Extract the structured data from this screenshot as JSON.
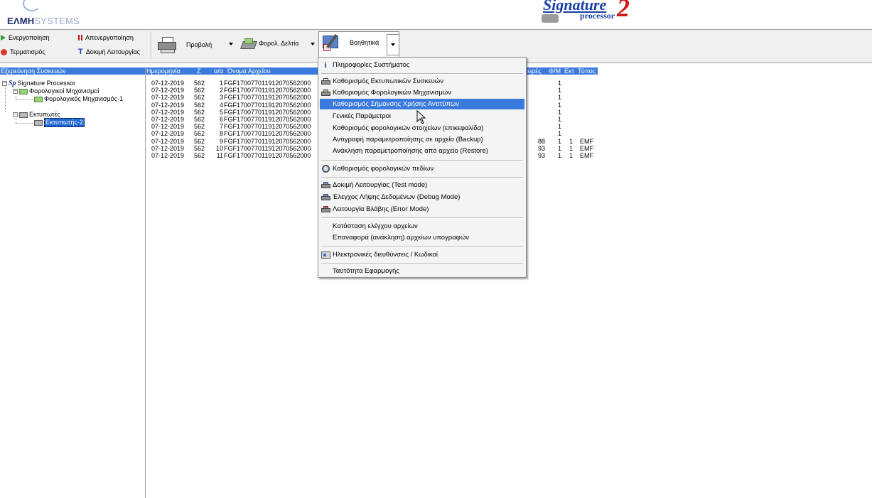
{
  "banner": {
    "brand_main": "ΕΛΜΗ",
    "brand_sub": "SYSTEMS",
    "product_word": "Signature",
    "product_num": "2",
    "product_sub": "processor"
  },
  "toolbar": {
    "activate": "Ενεργοποίηση",
    "deactivate": "Απενεργοποίηση",
    "terminate": "Τερματισμός",
    "test_run": "Δοκιμή Λειτουργίας",
    "preview": "Προβολή",
    "tax_slips": "Φορολ. Δελτία",
    "utilities": "Βοηθητικά"
  },
  "tree": {
    "header": "Εξερεύνηση Συσκευών",
    "root_prefix": "Sp",
    "root_label": "Signature Processor",
    "fiscal_group": "Φορολογικοί Μηχανισμοί",
    "fiscal_item": "Φορολογικός Μηχανισμός-1",
    "printers_group": "Εκτυπωτές",
    "printer_item": "Εκτυπωτής-2"
  },
  "list": {
    "headers": {
      "date": "Ημερομηνία",
      "z": "Z",
      "seq": "α/α",
      "filename": "Όνομα Αρχείου",
      "rows_col": "ειρές",
      "fm": "Φ/Μ",
      "ext": "Εκτ",
      "type": "Τύπος"
    },
    "rows": [
      {
        "date": "07-12-2019",
        "z": "562",
        "seq": "1",
        "file": "FGF170077011912070562000",
        "lines": "",
        "fm": "1",
        "ext": "",
        "type": ""
      },
      {
        "date": "07-12-2019",
        "z": "562",
        "seq": "2",
        "file": "FGF170077011912070562000",
        "lines": "",
        "fm": "1",
        "ext": "",
        "type": ""
      },
      {
        "date": "07-12-2019",
        "z": "562",
        "seq": "3",
        "file": "FGF170077011912070562000",
        "lines": "",
        "fm": "1",
        "ext": "",
        "type": ""
      },
      {
        "date": "07-12-2019",
        "z": "562",
        "seq": "4",
        "file": "FGF170077011912070562000",
        "lines": "",
        "fm": "1",
        "ext": "",
        "type": ""
      },
      {
        "date": "07-12-2019",
        "z": "562",
        "seq": "5",
        "file": "FGF170077011912070562000",
        "lines": "",
        "fm": "1",
        "ext": "",
        "type": ""
      },
      {
        "date": "07-12-2019",
        "z": "562",
        "seq": "6",
        "file": "FGF170077011912070562000",
        "lines": "",
        "fm": "1",
        "ext": "",
        "type": ""
      },
      {
        "date": "07-12-2019",
        "z": "562",
        "seq": "7",
        "file": "FGF170077011912070562000",
        "lines": "",
        "fm": "1",
        "ext": "",
        "type": ""
      },
      {
        "date": "07-12-2019",
        "z": "562",
        "seq": "8",
        "file": "FGF170077011912070562000",
        "lines": "",
        "fm": "1",
        "ext": "",
        "type": ""
      },
      {
        "date": "07-12-2019",
        "z": "562",
        "seq": "9",
        "file": "FGF170077011912070562000",
        "lines": "88",
        "fm": "1",
        "ext": "1",
        "type": "EMF"
      },
      {
        "date": "07-12-2019",
        "z": "562",
        "seq": "10",
        "file": "FGF170077011912070562000",
        "lines": "93",
        "fm": "1",
        "ext": "1",
        "type": "EMF"
      },
      {
        "date": "07-12-2019",
        "z": "562",
        "seq": "11",
        "file": "FGF170077011912070562000",
        "lines": "93",
        "fm": "1",
        "ext": "1",
        "type": "EMF"
      }
    ]
  },
  "menu": {
    "system_info": "Πληροφορίες Συστήματος",
    "printer_devices": "Καθορισμός Εκτυπωτικών Συσκευών",
    "fiscal_devices": "Καθορισμός Φορολογικών Μηχανισμών",
    "copy_marking": "Καθορισμός Σήμανσης Χρήσης Αντιτύπων",
    "general_params": "Γενικές Παράμετροι",
    "fiscal_header": "Καθορισμός φορολογικών στοιχείων (επικεφαλίδα)",
    "backup": "Αντιγραφή παραμετροποίησης σε αρχείο (Backup)",
    "restore": "Ανάκληση παραμετροποίησης από αρχείο (Restore)",
    "fiscal_fields": "Καθορισμός φορολογικών πεδίων",
    "test_mode": "Δοκιμή Λειτουργίας (Test mode)",
    "debug_mode": "Έλεγχος Λήψης Δεδομένων (Debug Mode)",
    "error_mode": "Λειτουργία Βλάβης (Error Mode)",
    "file_check": "Κατάσταση ελέγχου αρχείων",
    "signature_restore": "Επαναφορά (ανάκληση) αρχείων υπογραφών",
    "emails_codes": "Ηλεκτρονικές διευθύνσεις / Κωδικοί",
    "app_identity": "Ταυτότητα Εφαρμογής"
  },
  "colors": {
    "selection": "#3a7adc",
    "brand_blue": "#1b3fa8",
    "brand_red": "#d01818"
  }
}
